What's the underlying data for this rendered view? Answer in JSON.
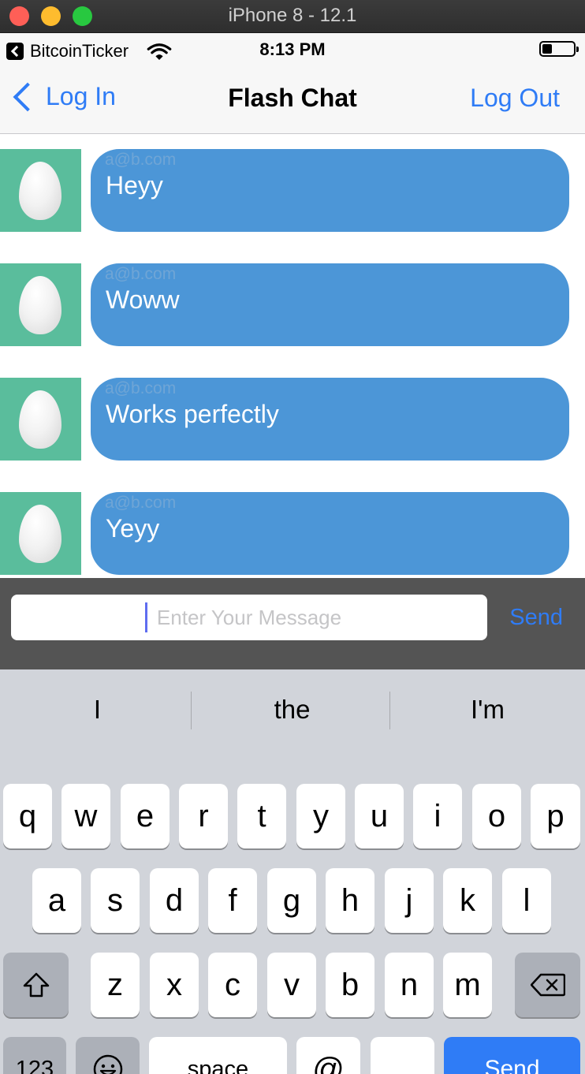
{
  "window": {
    "title": "iPhone 8 - 12.1"
  },
  "status_bar": {
    "back_app": "BitcoinTicker",
    "time": "8:13 PM",
    "icons": [
      "back-to-app-icon",
      "wifi-icon",
      "battery-icon"
    ]
  },
  "nav": {
    "back_label": "Log In",
    "title": "Flash Chat",
    "right_label": "Log Out"
  },
  "messages": [
    {
      "sender": "a@b.com",
      "text": "Heyy"
    },
    {
      "sender": "a@b.com",
      "text": "Woww"
    },
    {
      "sender": "a@b.com",
      "text": "Works perfectly"
    },
    {
      "sender": "a@b.com",
      "text": "Yeyy"
    }
  ],
  "composer": {
    "placeholder": "Enter Your Message",
    "value": "",
    "send_label": "Send"
  },
  "keyboard": {
    "suggestions": [
      "I",
      "the",
      "I'm"
    ],
    "row1": [
      "q",
      "w",
      "e",
      "r",
      "t",
      "y",
      "u",
      "i",
      "o",
      "p"
    ],
    "row2": [
      "a",
      "s",
      "d",
      "f",
      "g",
      "h",
      "j",
      "k",
      "l"
    ],
    "row3": [
      "z",
      "x",
      "c",
      "v",
      "b",
      "n",
      "m"
    ],
    "numbers_label": "123",
    "space_label": "space",
    "at_label": "@",
    "period_label": ".",
    "send_label": "Send"
  },
  "colors": {
    "accent": "#2f7cf6",
    "bubble": "#4c96d7",
    "avatar_bg": "#5abd9c",
    "composer_bg": "#545454",
    "keyboard_bg": "#d1d4da"
  }
}
